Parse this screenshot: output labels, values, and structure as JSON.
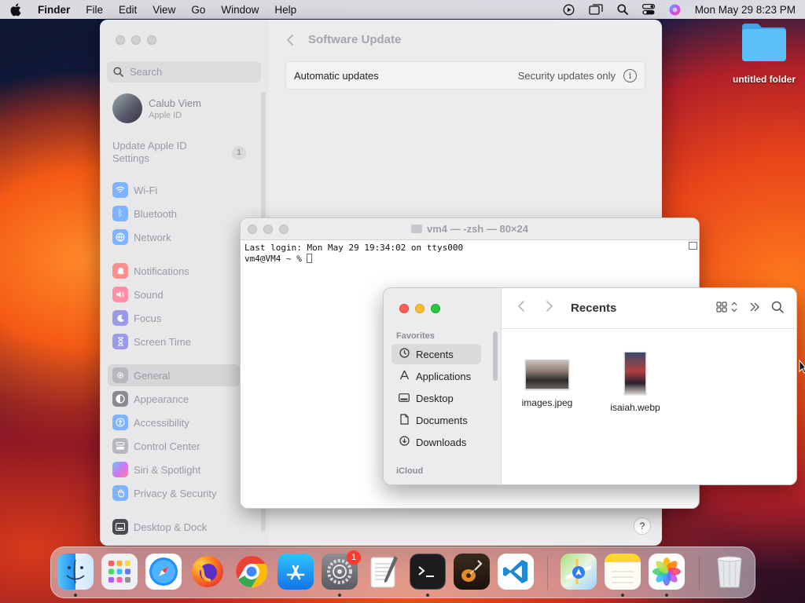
{
  "menubar": {
    "app_name": "Finder",
    "items": [
      "File",
      "Edit",
      "View",
      "Go",
      "Window",
      "Help"
    ],
    "clock": "Mon May 29  8:23 PM"
  },
  "desktop": {
    "folder_label": "untitled folder"
  },
  "settings": {
    "search_placeholder": "Search",
    "profile_name": "Calub Viem",
    "profile_sub": "Apple ID",
    "update_text": "Update Apple ID Settings",
    "update_badge": "1",
    "items": [
      {
        "label": "Wi-Fi",
        "icon": "wifi-icon",
        "color": "#3d8bff"
      },
      {
        "label": "Bluetooth",
        "icon": "bluetooth-icon",
        "color": "#3d8bff"
      },
      {
        "label": "Network",
        "icon": "network-icon",
        "color": "#3d8bff"
      },
      {
        "label": "Notifications",
        "icon": "bell-icon",
        "color": "#ff4b45"
      },
      {
        "label": "Sound",
        "icon": "speaker-icon",
        "color": "#ff4b6e"
      },
      {
        "label": "Focus",
        "icon": "moon-icon",
        "color": "#5b5bd6"
      },
      {
        "label": "Screen Time",
        "icon": "hourglass-icon",
        "color": "#5b5bd6"
      },
      {
        "label": "General",
        "icon": "gear-icon",
        "color": "#9a9aa0"
      },
      {
        "label": "Appearance",
        "icon": "appearance-icon",
        "color": "#333333"
      },
      {
        "label": "Accessibility",
        "icon": "accessibility-icon",
        "color": "#3d8bff"
      },
      {
        "label": "Control Center",
        "icon": "control-center-icon",
        "color": "#9a9aa0"
      },
      {
        "label": "Siri & Spotlight",
        "icon": "siri-icon",
        "color": "#b04fd8"
      },
      {
        "label": "Privacy & Security",
        "icon": "hand-icon",
        "color": "#3d8bff"
      },
      {
        "label": "Desktop & Dock",
        "icon": "dock-icon",
        "color": "#333333"
      }
    ],
    "page_title": "Software Update",
    "auto_updates_label": "Automatic updates",
    "auto_updates_value": "Security updates only",
    "help_label": "?"
  },
  "terminal": {
    "title": "vm4 — -zsh — 80×24",
    "line1": "Last login: Mon May 29 19:34:02 on ttys000",
    "prompt": "vm4@VM4 ~ % "
  },
  "finder": {
    "title": "Recents",
    "favorites_header": "Favorites",
    "icloud_header": "iCloud",
    "favorites": [
      {
        "label": "Recents",
        "icon": "clock-icon"
      },
      {
        "label": "Applications",
        "icon": "applications-icon"
      },
      {
        "label": "Desktop",
        "icon": "desktop-icon"
      },
      {
        "label": "Documents",
        "icon": "document-icon"
      },
      {
        "label": "Downloads",
        "icon": "download-icon"
      }
    ],
    "files": [
      {
        "name": "images.jpeg"
      },
      {
        "name": "isaiah.webp"
      }
    ]
  },
  "dock": {
    "apps": [
      {
        "name": "Finder",
        "icon": "finder-icon",
        "running": true
      },
      {
        "name": "Launchpad",
        "icon": "launchpad-icon",
        "running": false
      },
      {
        "name": "Safari",
        "icon": "safari-icon",
        "running": false
      },
      {
        "name": "Firefox",
        "icon": "firefox-icon",
        "running": false
      },
      {
        "name": "Chrome",
        "icon": "chrome-icon",
        "running": false
      },
      {
        "name": "App Store",
        "icon": "app-store-icon",
        "running": false
      },
      {
        "name": "System Settings",
        "icon": "system-settings-icon",
        "running": true,
        "badge": "1"
      },
      {
        "name": "TextEdit",
        "icon": "textedit-icon",
        "running": false
      },
      {
        "name": "Terminal",
        "icon": "terminal-icon",
        "running": true
      },
      {
        "name": "GarageBand",
        "icon": "garageband-icon",
        "running": false
      },
      {
        "name": "VS Code",
        "icon": "vscode-icon",
        "running": false
      },
      {
        "name": "Maps",
        "icon": "maps-icon",
        "running": false
      },
      {
        "name": "Notes",
        "icon": "notes-icon",
        "running": true
      },
      {
        "name": "Photos",
        "icon": "photos-icon",
        "running": true
      },
      {
        "name": "Trash",
        "icon": "trash-icon",
        "running": false
      }
    ]
  }
}
